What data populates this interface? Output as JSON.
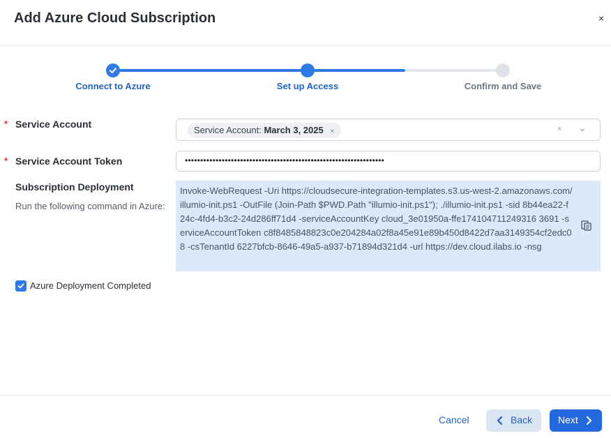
{
  "dialog": {
    "title": "Add Azure Cloud Subscription",
    "close_glyph": "×"
  },
  "stepper": {
    "steps": [
      {
        "label": "Connect to Azure",
        "state": "complete"
      },
      {
        "label": "Set up Access",
        "state": "active"
      },
      {
        "label": "Confirm and Save",
        "state": "pending"
      }
    ]
  },
  "form": {
    "required_mark": "*",
    "service_account": {
      "label": "Service Account",
      "chip_prefix": "Service Account:",
      "chip_value": "March 3, 2025",
      "chip_remove_glyph": "×",
      "clear_glyph": "×"
    },
    "token": {
      "label": "Service Account Token",
      "value": "•••••••••••••••••••••••••••••••••••••••••••••••••••••••••••••••••"
    },
    "deployment": {
      "label": "Subscription Deployment",
      "description": "Run the following command in Azure:",
      "command": "Invoke-WebRequest -Uri https://cloudsecure-integration-templates.s3.us-west-2.amazonaws.com/illumio-init.ps1 -OutFile (Join-Path $PWD.Path \"illumio-init.ps1\"); ./illumio-init.ps1 -sid 8b44ea22-f24c-4fd4-b3c2-24d286ff71d4 -serviceAccountKey cloud_3e01950a-ffe174104711249316 3691 -serviceAccountToken c8f8485848823c0e204284a02f8a45e91e89b450d8422d7aa3149354cf2edc08 -csTenantId 6227bfcb-8646-49a5-a937-b71894d321d4 -url https://dev.cloud.ilabs.io -nsg"
    },
    "checkbox": {
      "label": "Azure Deployment Completed",
      "checked": true
    }
  },
  "footer": {
    "cancel_label": "Cancel",
    "back_label": "Back",
    "next_label": "Next"
  },
  "colors": {
    "primary": "#2f7be6",
    "link": "#1f63c7",
    "code_bg": "#dbe9fa",
    "required": "#d9342b"
  },
  "icons": [
    "close-icon",
    "check-icon",
    "chevron-down-icon",
    "copy-icon",
    "chevron-left-icon",
    "chevron-right-icon"
  ]
}
